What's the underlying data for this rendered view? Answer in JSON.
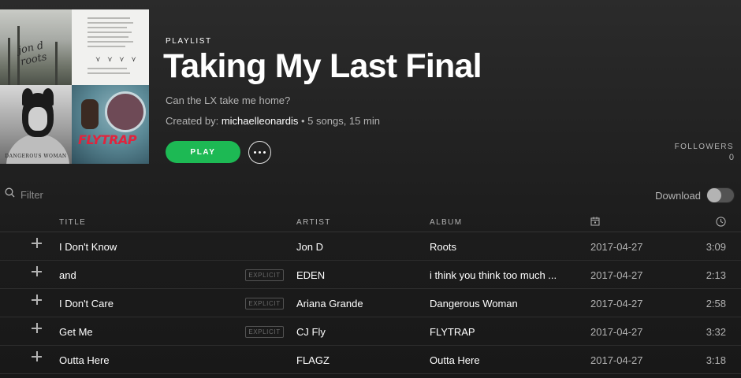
{
  "playlist": {
    "type_label": "PLAYLIST",
    "title": "Taking My Last Final",
    "description": "Can the LX take me home?",
    "created_by_label": "Created by: ",
    "owner": "michaelleonardis",
    "stats": " • 5 songs, 15 min",
    "cover_art": {
      "tile1_text": "jon d roots",
      "tile4_text": "FLYTRAP",
      "tile3_text": "DANGEROUS WOMAN"
    }
  },
  "actions": {
    "play_label": "PLAY",
    "more_icon": "ellipsis-icon"
  },
  "followers": {
    "label": "FOLLOWERS",
    "count": "0"
  },
  "filter": {
    "placeholder": "Filter",
    "icon": "search-icon"
  },
  "download": {
    "label": "Download",
    "enabled": false
  },
  "table": {
    "headers": {
      "title": "TITLE",
      "artist": "ARTIST",
      "album": "ALBUM",
      "date_icon": "calendar-icon",
      "duration_icon": "clock-icon"
    },
    "explicit_label": "EXPLICIT",
    "rows": [
      {
        "title": "I Don't Know",
        "explicit": false,
        "artist": "Jon D",
        "album": "Roots",
        "date": "2017-04-27",
        "duration": "3:09"
      },
      {
        "title": "and",
        "explicit": true,
        "artist": "EDEN",
        "album": "i think you think too much ...",
        "date": "2017-04-27",
        "duration": "2:13"
      },
      {
        "title": "I Don't Care",
        "explicit": true,
        "artist": "Ariana Grande",
        "album": "Dangerous Woman",
        "date": "2017-04-27",
        "duration": "2:58"
      },
      {
        "title": "Get Me",
        "explicit": true,
        "artist": "CJ Fly",
        "album": "FLYTRAP",
        "date": "2017-04-27",
        "duration": "3:32"
      },
      {
        "title": "Outta Here",
        "explicit": false,
        "artist": "FLAGZ",
        "album": "Outta Here",
        "date": "2017-04-27",
        "duration": "3:18"
      }
    ]
  },
  "colors": {
    "accent": "#1db954",
    "text_primary": "#ffffff",
    "text_secondary": "#b3b3b3",
    "background": "#181818"
  }
}
